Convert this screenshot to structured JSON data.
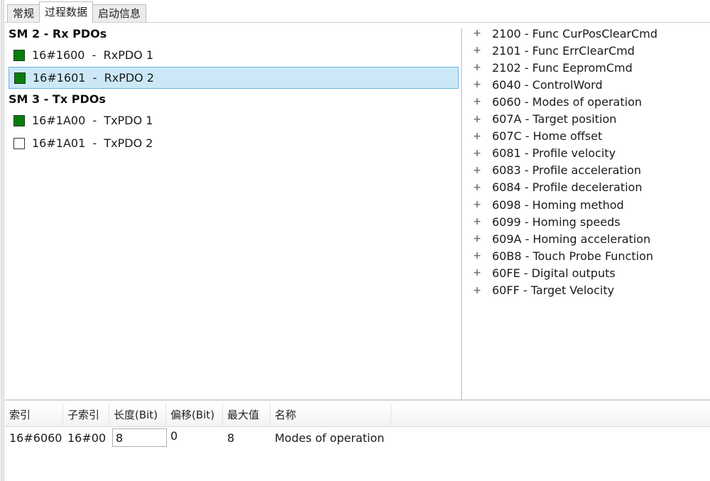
{
  "tabs": [
    {
      "label": "常规",
      "active": false
    },
    {
      "label": "过程数据",
      "active": true
    },
    {
      "label": "启动信息",
      "active": false
    }
  ],
  "pdo_groups": [
    {
      "title": "SM 2 - Rx PDOs",
      "items": [
        {
          "index": "16#1600",
          "name": "RxPDO 1",
          "checked": true,
          "selected": false
        },
        {
          "index": "16#1601",
          "name": "RxPDO 2",
          "checked": true,
          "selected": true
        }
      ]
    },
    {
      "title": "SM 3 - Tx PDOs",
      "items": [
        {
          "index": "16#1A00",
          "name": "TxPDO 1",
          "checked": true,
          "selected": false
        },
        {
          "index": "16#1A01",
          "name": "TxPDO 2",
          "checked": false,
          "selected": false
        }
      ]
    }
  ],
  "object_list": [
    {
      "icon": "expand-plus-icon",
      "label": "2100 - Func CurPosClearCmd"
    },
    {
      "icon": "expand-plus-icon",
      "label": "2101 - Func ErrClearCmd"
    },
    {
      "icon": "expand-plus-icon",
      "label": "2102 - Func EepromCmd"
    },
    {
      "icon": "expand-plus-icon",
      "label": "6040 - ControlWord"
    },
    {
      "icon": "expand-plus-icon",
      "label": "6060 - Modes of operation"
    },
    {
      "icon": "expand-plus-icon",
      "label": "607A - Target position"
    },
    {
      "icon": "expand-plus-icon",
      "label": "607C - Home offset"
    },
    {
      "icon": "expand-plus-icon",
      "label": "6081 - Profile velocity"
    },
    {
      "icon": "expand-plus-icon",
      "label": "6083 - Profile acceleration"
    },
    {
      "icon": "expand-plus-icon",
      "label": "6084 - Profile deceleration"
    },
    {
      "icon": "expand-plus-icon",
      "label": "6098 - Homing method"
    },
    {
      "icon": "expand-plus-icon",
      "label": "6099 - Homing speeds"
    },
    {
      "icon": "expand-plus-icon",
      "label": "609A - Homing acceleration"
    },
    {
      "icon": "expand-plus-icon",
      "label": "60B8 - Touch Probe Function"
    },
    {
      "icon": "expand-plus-icon",
      "label": "60FE - Digital outputs"
    },
    {
      "icon": "expand-plus-icon",
      "label": "60FF - Target Velocity"
    }
  ],
  "mapping_table": {
    "columns": [
      "索引",
      "子索引",
      "长度(Bit)",
      "偏移(Bit)",
      "最大值",
      "名称"
    ],
    "rows": [
      {
        "index": "16#6060",
        "subindex": "16#00",
        "length": "8",
        "offset": "0",
        "max": "8",
        "name": "Modes of operation"
      }
    ]
  },
  "colors": {
    "checked_fill": "#0b7d0b",
    "selection_bg": "#cce8f6",
    "selection_border": "#6cb5e0"
  }
}
